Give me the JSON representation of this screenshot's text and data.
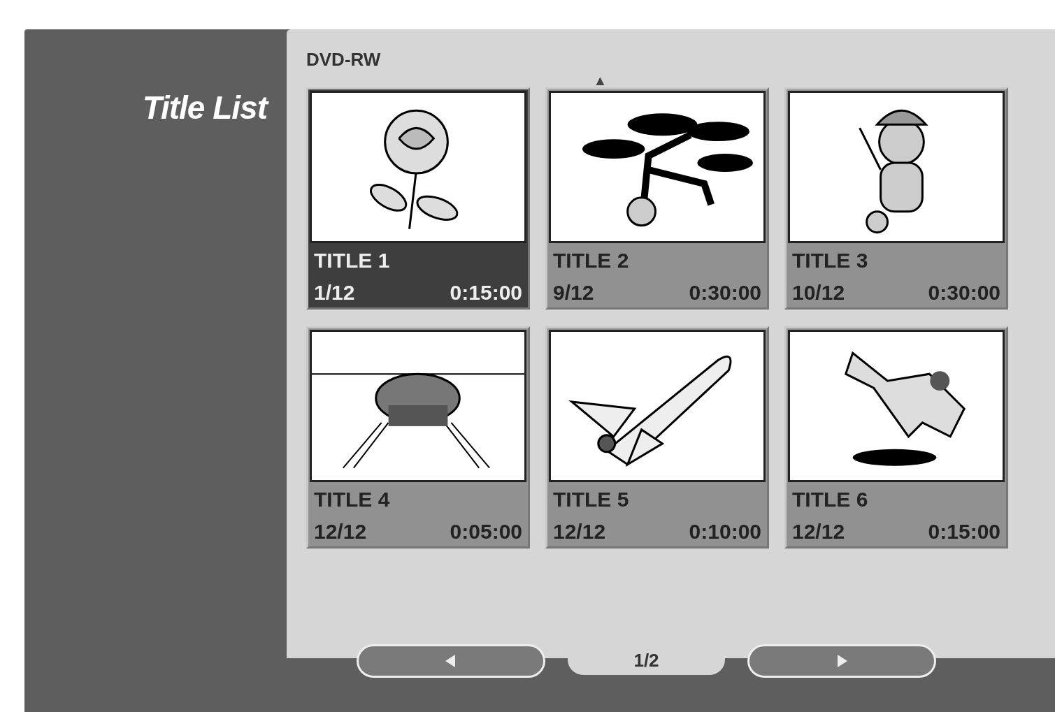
{
  "menu_title": "Title List",
  "disc_label": "DVD-RW",
  "scroll_up": "▲",
  "titles": [
    {
      "name": "TITLE 1",
      "date": "1/12",
      "duration": "0:15:00",
      "kind": "rose",
      "selected": true
    },
    {
      "name": "TITLE 2",
      "date": "9/12",
      "duration": "0:30:00",
      "kind": "tree",
      "selected": false
    },
    {
      "name": "TITLE 3",
      "date": "10/12",
      "duration": "0:30:00",
      "kind": "figure",
      "selected": false
    },
    {
      "name": "TITLE 4",
      "date": "12/12",
      "duration": "0:05:00",
      "kind": "car",
      "selected": false
    },
    {
      "name": "TITLE 5",
      "date": "12/12",
      "duration": "0:10:00",
      "kind": "shuttle",
      "selected": false
    },
    {
      "name": "TITLE 6",
      "date": "12/12",
      "duration": "0:15:00",
      "kind": "dog",
      "selected": false
    }
  ],
  "page": "1/2"
}
